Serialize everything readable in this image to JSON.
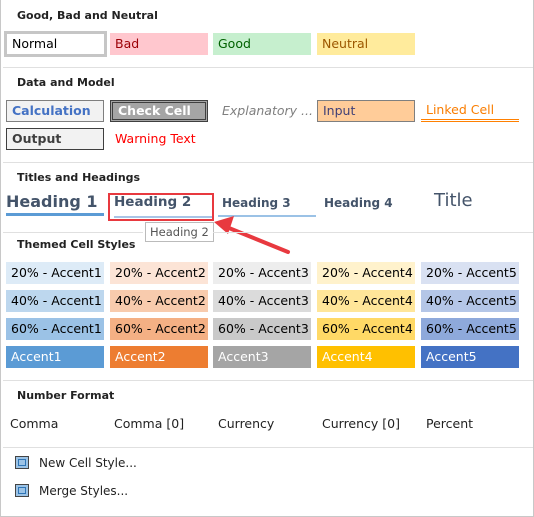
{
  "sections": {
    "good_bad": "Good, Bad and Neutral",
    "data_model": "Data and Model",
    "titles": "Titles and Headings",
    "themed": "Themed Cell Styles",
    "number": "Number Format"
  },
  "good_bad": [
    "Normal",
    "Bad",
    "Good",
    "Neutral"
  ],
  "data_model": [
    "Calculation",
    "Check Cell",
    "Explanatory ...",
    "Input",
    "Linked Cell",
    "Output",
    "Warning Text"
  ],
  "headings": [
    "Heading 1",
    "Heading 2",
    "Heading 3",
    "Heading 4",
    "Title"
  ],
  "tooltip": "Heading 2",
  "themed": [
    [
      "20% - Accent1",
      "20% - Accent2",
      "20% - Accent3",
      "20% - Accent4",
      "20% - Accent5"
    ],
    [
      "40% - Accent1",
      "40% - Accent2",
      "40% - Accent3",
      "40% - Accent4",
      "40% - Accent5"
    ],
    [
      "60% - Accent1",
      "60% - Accent2",
      "60% - Accent3",
      "60% - Accent4",
      "60% - Accent5"
    ],
    [
      "Accent1",
      "Accent2",
      "Accent3",
      "Accent4",
      "Accent5"
    ]
  ],
  "themed_colors": [
    [
      "#ddebf7",
      "#fce4d6",
      "#ededed",
      "#fff2cc",
      "#d9e1f2"
    ],
    [
      "#bdd7ee",
      "#f8cbad",
      "#dbdbdb",
      "#ffe699",
      "#b4c6e7"
    ],
    [
      "#9bc2e6",
      "#f4b084",
      "#c9c9c9",
      "#ffd966",
      "#8ea9db"
    ],
    [
      "#5b9bd5",
      "#ed7d31",
      "#a5a5a5",
      "#ffc000",
      "#4472c4"
    ]
  ],
  "number_format": [
    "Comma",
    "Comma [0]",
    "Currency",
    "Currency [0]",
    "Percent"
  ],
  "actions": {
    "new_style": "New Cell Style...",
    "merge_styles": "Merge Styles..."
  },
  "highlight_color": "#e8393f"
}
